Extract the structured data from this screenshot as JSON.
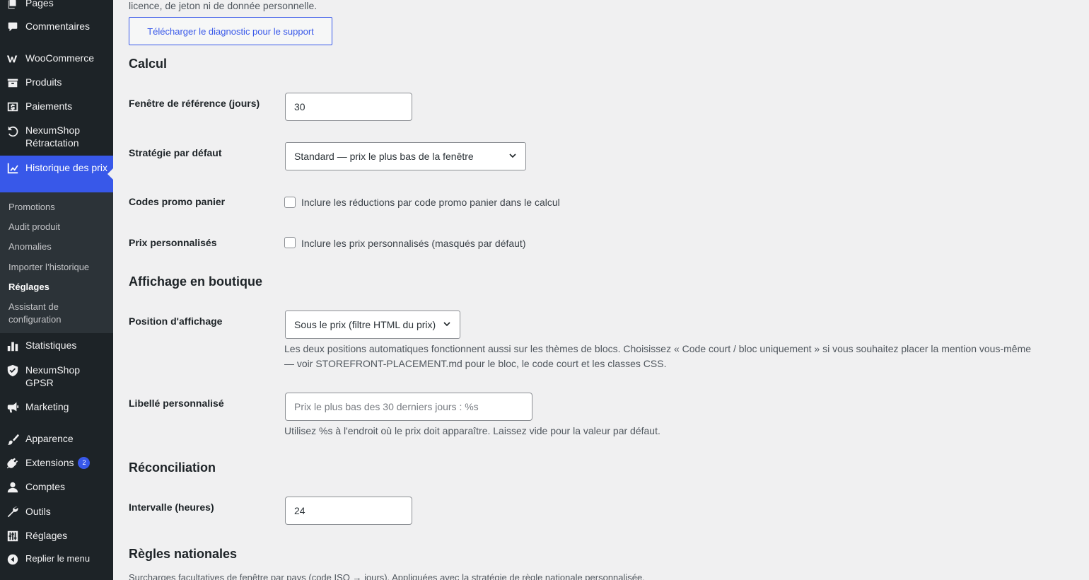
{
  "sidebar": {
    "items": [
      {
        "label": "Pages",
        "icon": "pages-icon"
      },
      {
        "label": "Commentaires",
        "icon": "comments-icon"
      },
      {
        "label": "WooCommerce",
        "icon": "woocommerce-icon"
      },
      {
        "label": "Produits",
        "icon": "products-icon"
      },
      {
        "label": "Paiements",
        "icon": "payments-icon"
      },
      {
        "label": "NexumShop Rétractation",
        "icon": "undo-icon"
      },
      {
        "label": "Historique des prix",
        "icon": "chart-line-icon"
      },
      {
        "label": "Statistiques",
        "icon": "bar-chart-icon"
      },
      {
        "label": "NexumShop GPSR",
        "icon": "shield-icon"
      },
      {
        "label": "Marketing",
        "icon": "megaphone-icon"
      },
      {
        "label": "Apparence",
        "icon": "paintbrush-icon"
      },
      {
        "label": "Extensions",
        "icon": "plugin-icon",
        "badge": "2"
      },
      {
        "label": "Comptes",
        "icon": "user-icon"
      },
      {
        "label": "Outils",
        "icon": "wrench-icon"
      },
      {
        "label": "Réglages",
        "icon": "settings-sliders-icon"
      },
      {
        "label": "Replier le menu",
        "icon": "collapse-icon"
      }
    ],
    "submenu": [
      {
        "label": "Promotions"
      },
      {
        "label": "Audit produit"
      },
      {
        "label": "Anomalies"
      },
      {
        "label": "Importer l’historique"
      },
      {
        "label": "Réglages",
        "active": true
      },
      {
        "label": "Assistant de configuration"
      }
    ],
    "colors": {
      "background": "#1d2327",
      "submenu": "#2c3338",
      "accent": "#3858e9"
    }
  },
  "main": {
    "top_note": "licence, de jeton ni de donnée personnelle.",
    "download_button": "Télécharger le diagnostic pour le support",
    "sections": {
      "calcul": "Calcul",
      "affichage": "Affichage en boutique",
      "reconciliation": "Réconciliation",
      "regles": "Règles nationales"
    },
    "fields": {
      "window_label": "Fenêtre de référence (jours)",
      "window_value": "30",
      "strategy_label": "Stratégie par défaut",
      "strategy_value": "Standard — prix le plus bas de la fenêtre",
      "coupons_label": "Codes promo panier",
      "coupons_checkbox": "Inclure les réductions par code promo panier dans le calcul",
      "custom_prices_label": "Prix personnalisés",
      "custom_prices_checkbox": "Inclure les prix personnalisés (masqués par défaut)",
      "position_label": "Position d'affichage",
      "position_value": "Sous le prix (filtre HTML du prix)",
      "position_desc_1": "Les deux positions automatiques fonctionnent aussi sur les thèmes de blocs. Choisissez « Code court / bloc uniquement » si vous souhaitez placer la mention vous-même",
      "position_desc_2": "— voir STOREFRONT-PLACEMENT.md pour le bloc, le code court et les classes CSS.",
      "custom_label_label": "Libellé personnalisé",
      "custom_label_placeholder": "Prix le plus bas des 30 derniers jours : %s",
      "custom_label_desc": "Utilisez %s à l'endroit où le prix doit apparaître. Laissez vide pour la valeur par défaut.",
      "interval_label": "Intervalle (heures)",
      "interval_value": "24",
      "national_desc": "Surcharges facultatives de fenêtre par pays (code ISO → jours). Appliquées avec la stratégie de règle nationale personnalisée."
    }
  }
}
